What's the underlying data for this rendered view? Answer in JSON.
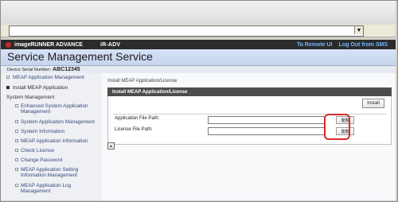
{
  "brand": {
    "name": "imageRUNNER ADVANCE",
    "product": "iR-ADV",
    "links": [
      "To Remote UI",
      "Log Out from SMS"
    ]
  },
  "page": {
    "title": "Service Management Service",
    "serial_label": "Device Serial Number:",
    "serial_value": "ABC12345"
  },
  "sidebar": {
    "items": [
      {
        "label": "MEAP Application Management"
      },
      {
        "label": "Install MEAP Application"
      },
      {
        "label": "System Management"
      },
      {
        "label": "Enhanced System Application Management"
      },
      {
        "label": "System Application Management"
      },
      {
        "label": "System Information"
      },
      {
        "label": "MEAP Application Information"
      },
      {
        "label": "Check License"
      },
      {
        "label": "Change Password"
      },
      {
        "label": "MEAP Application Setting Information Management"
      },
      {
        "label": "MEAP Application Log Management"
      }
    ]
  },
  "main": {
    "section_title": "Install MEAP Application/License",
    "panel_title": "Install MEAP Application/License",
    "install_label": "Install",
    "fields": [
      {
        "label": "Application File Path:",
        "value": "",
        "browse_label": "閲覧"
      },
      {
        "label": "License File Path:",
        "value": "",
        "browse_label": "閲覧"
      }
    ]
  }
}
